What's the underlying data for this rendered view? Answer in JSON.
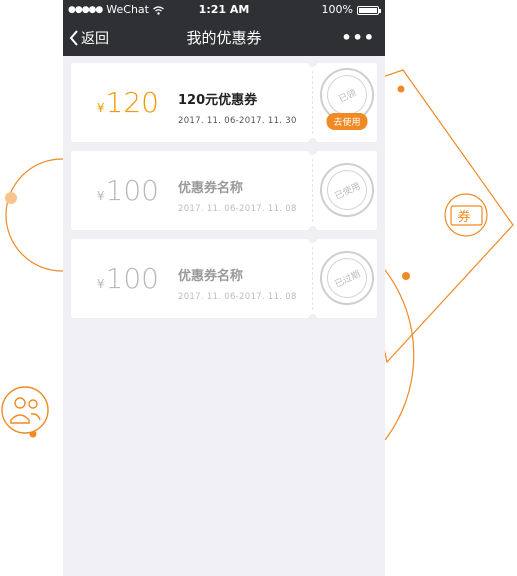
{
  "status_bar": {
    "carrier": "WeChat",
    "time": "1:21 AM",
    "battery": "100%"
  },
  "nav": {
    "back_label": "返回",
    "title": "我的优惠券",
    "more_label": "•••"
  },
  "coupons": [
    {
      "yen": "¥",
      "amount": "120",
      "name": "120元优惠券",
      "date": "2017. 11. 06-2017. 11. 30",
      "stamp": "已领",
      "action": "去使用",
      "state": "active"
    },
    {
      "yen": "¥",
      "amount": "100",
      "name": "优惠券名称",
      "date": "2017. 11. 06-2017. 11. 08",
      "stamp": "已使用",
      "state": "used"
    },
    {
      "yen": "¥",
      "amount": "100",
      "name": "优惠券名称",
      "date": "2017. 11. 06-2017. 11. 08",
      "stamp": "已过期",
      "state": "expired"
    }
  ],
  "decor": {
    "coupon_icon_label": "券",
    "accent_color": "#f39800",
    "line_color": "#f08a24"
  }
}
